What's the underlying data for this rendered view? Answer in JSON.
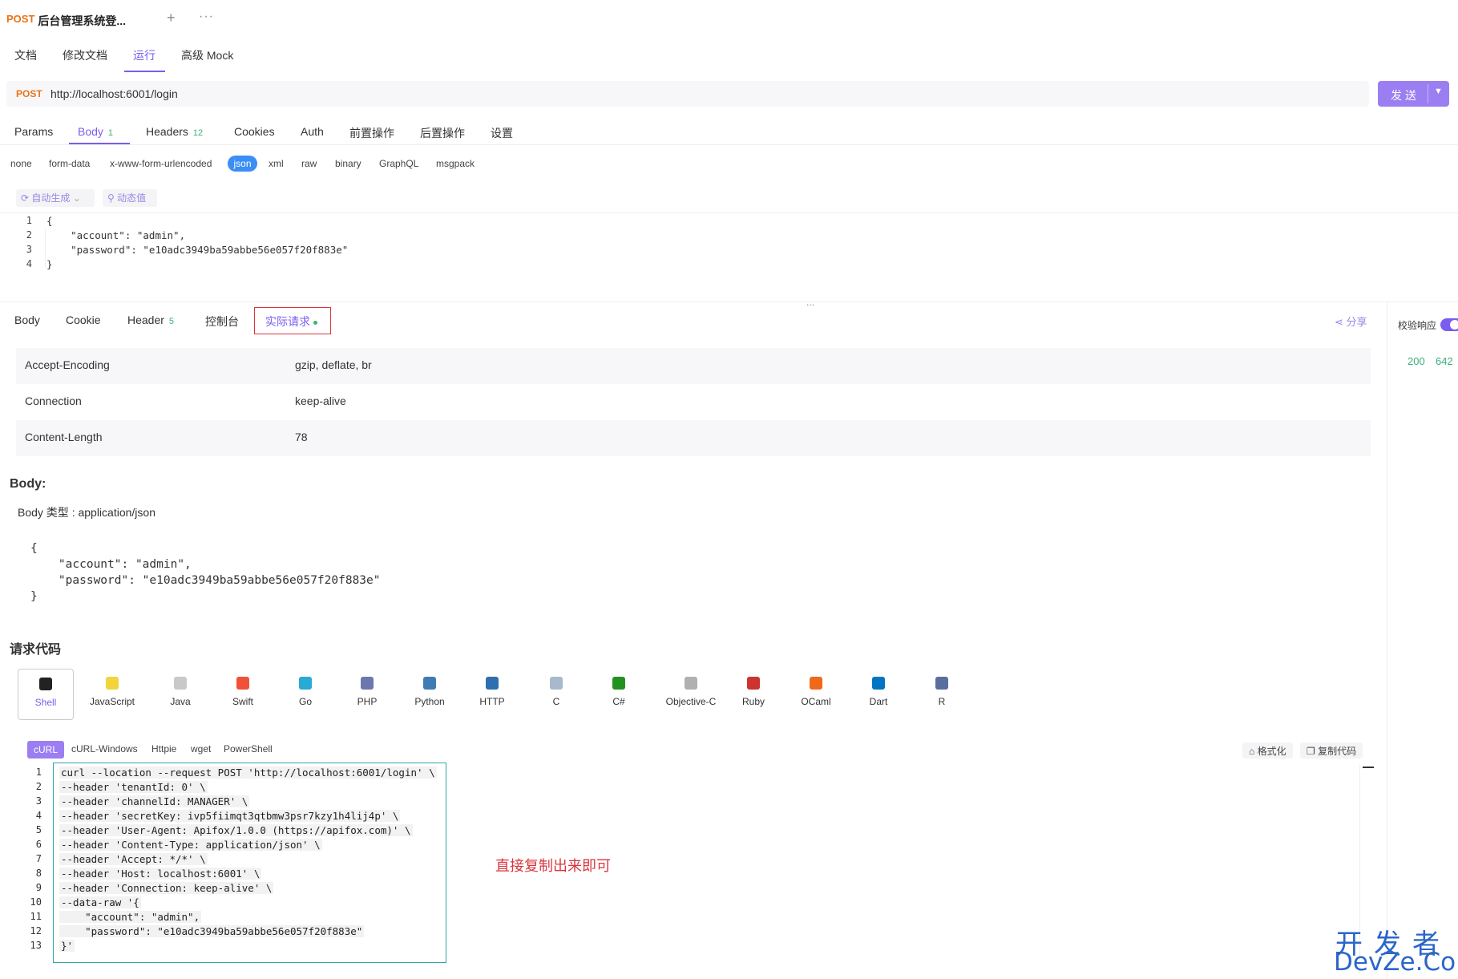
{
  "tab": {
    "method": "POST",
    "title": "后台管理系统登...",
    "plus": "+",
    "more": "···"
  },
  "subtabs": [
    "文档",
    "修改文档",
    "运行",
    "高级 Mock"
  ],
  "request": {
    "method": "POST",
    "url": "http://localhost:6001/login",
    "send_label": "发送"
  },
  "param_tabs": [
    {
      "label": "Params",
      "count": ""
    },
    {
      "label": "Body",
      "count": "1"
    },
    {
      "label": "Headers",
      "count": "12"
    },
    {
      "label": "Cookies",
      "count": ""
    },
    {
      "label": "Auth",
      "count": ""
    },
    {
      "label": "前置操作",
      "count": ""
    },
    {
      "label": "后置操作",
      "count": ""
    },
    {
      "label": "设置",
      "count": ""
    }
  ],
  "body_types": [
    "none",
    "form-data",
    "x-www-form-urlencoded",
    "json",
    "xml",
    "raw",
    "binary",
    "GraphQL",
    "msgpack"
  ],
  "editor_tools": {
    "autogen": "自动生成",
    "dynamic": "动态值"
  },
  "body_editor": {
    "line_numbers": [
      "1",
      "2",
      "3",
      "4"
    ],
    "lines": [
      "{",
      "    \"account\": \"admin\",",
      "    \"password\": \"e10adc3949ba59abbe56e057f20f883e\"",
      "}"
    ]
  },
  "resize_handle": "...",
  "response_tabs": [
    {
      "label": "Body",
      "count": ""
    },
    {
      "label": "Cookie",
      "count": ""
    },
    {
      "label": "Header",
      "count": "5"
    },
    {
      "label": "控制台",
      "count": ""
    },
    {
      "label": "实际请求",
      "count": ""
    }
  ],
  "share_label": "分享",
  "verify_label": "校验响应",
  "status": {
    "code": "200",
    "time": "642"
  },
  "headers": [
    {
      "key": "Accept-Encoding",
      "value": "gzip, deflate, br"
    },
    {
      "key": "Connection",
      "value": "keep-alive"
    },
    {
      "key": "Content-Length",
      "value": "78"
    }
  ],
  "body_section": {
    "heading": "Body:",
    "type_label": "Body 类型 : application/json",
    "lines": [
      "{",
      "    \"account\": \"admin\",",
      "    \"password\": \"e10adc3949ba59abbe56e057f20f883e\"",
      "}"
    ]
  },
  "request_code": {
    "heading": "请求代码",
    "languages": [
      "Shell",
      "JavaScript",
      "Java",
      "Swift",
      "Go",
      "PHP",
      "Python",
      "HTTP",
      "C",
      "C#",
      "Objective-C",
      "Ruby",
      "OCaml",
      "Dart",
      "R"
    ],
    "language_colors": [
      "#222222",
      "#f0d53c",
      "#c9c9c9",
      "#f05138",
      "#29a9d6",
      "#6c78ad",
      "#3f7cb4",
      "#2f6fb0",
      "#a8b9cc",
      "#239120",
      "#b0b0b0",
      "#cc342d",
      "#ee6a1a",
      "#0175c2",
      "#5a6e9e"
    ],
    "clients": [
      "cURL",
      "cURL-Windows",
      "Httpie",
      "wget",
      "PowerShell"
    ],
    "format_label": "格式化",
    "copy_label": "复制代码",
    "line_numbers": [
      "1",
      "2",
      "3",
      "4",
      "5",
      "6",
      "7",
      "8",
      "9",
      "10",
      "11",
      "12",
      "13"
    ],
    "lines": [
      "curl --location --request POST 'http://localhost:6001/login' \\",
      "--header 'tenantId: 0' \\",
      "--header 'channelId: MANAGER' \\",
      "--header 'secretKey: ivp5fiimqt3qtbmw3psr7kzy1h4lij4p' \\",
      "--header 'User-Agent: Apifox/1.0.0 (https://apifox.com)' \\",
      "--header 'Content-Type: application/json' \\",
      "--header 'Accept: */*' \\",
      "--header 'Host: localhost:6001' \\",
      "--header 'Connection: keep-alive' \\",
      "--data-raw '{",
      "    \"account\": \"admin\",",
      "    \"password\": \"e10adc3949ba59abbe56e057f20f883e\"",
      "}'"
    ]
  },
  "annotation": "直接复制出来即可",
  "watermark": {
    "cn": "开发者",
    "en": "DevZe.CoM"
  }
}
